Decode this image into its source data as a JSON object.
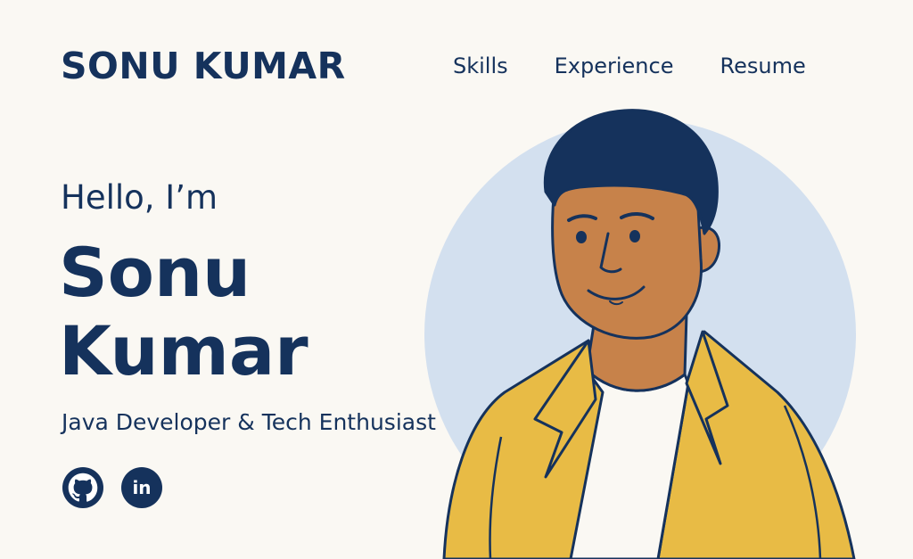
{
  "header": {
    "brand": "SONU KUMAR",
    "nav": [
      {
        "label": "Skills"
      },
      {
        "label": "Experience"
      },
      {
        "label": "Resume"
      }
    ]
  },
  "hero": {
    "greeting": "Hello, I’m",
    "name_line1": "Sonu",
    "name_line2": "Kumar",
    "tagline": "Java Developer & Tech Enthusiast",
    "socials": [
      {
        "name": "github",
        "icon": "github-icon"
      },
      {
        "name": "linkedin",
        "icon": "linkedin-icon",
        "text": "in"
      }
    ]
  },
  "illustration": {
    "subject": "avatar-illustration"
  },
  "colors": {
    "primary": "#15325c",
    "background": "#faf8f3",
    "circle": "#d3e0ef",
    "skin": "#c7824a",
    "jacket": "#e8bb45",
    "shirt": "#faf8f3"
  }
}
